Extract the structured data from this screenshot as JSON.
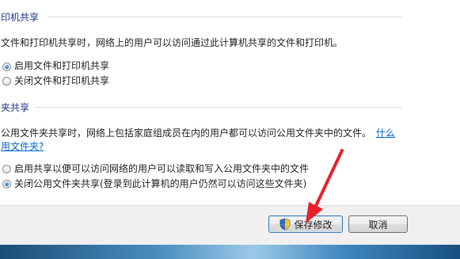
{
  "printer_sharing": {
    "title": "印机共享",
    "description": "文件和打印机共享时，网络上的用户可以访问通过此计算机共享的文件和打印机。",
    "options": [
      {
        "label": "启用文件和打印机共享",
        "checked": true
      },
      {
        "label": "关闭文件和打印机共享",
        "checked": false
      }
    ]
  },
  "public_folder_sharing": {
    "title": "夹共享",
    "description": "公用文件夹共享时，网络上包括家庭组成员在内的用户都可以访问公用文件夹中的文件。",
    "link_part1": "什么",
    "link_part2": "用文件夹?",
    "options": [
      {
        "label": "启用共享以便可以访问网络的用户可以读取和写入公用文件夹中的文件",
        "checked": false
      },
      {
        "label": "关闭公用文件夹共享(登录到此计算机的用户仍然可以访问这些文件夹)",
        "checked": true
      }
    ]
  },
  "footer": {
    "save_label": "保存修改",
    "cancel_label": "取消",
    "shield_icon": "uac-shield-icon"
  },
  "annotation": {
    "arrow_color": "#e8202a"
  }
}
